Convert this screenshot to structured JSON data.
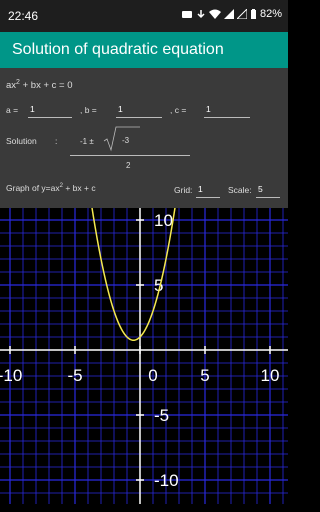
{
  "status": {
    "time": "22:46",
    "battery": "82%"
  },
  "app": {
    "title": "Solution of quadratic equation"
  },
  "equation": {
    "text_pre": "ax",
    "sup": "2",
    "text_post": " + bx + c = 0"
  },
  "inputs": {
    "a": {
      "label": "a =",
      "value": "1"
    },
    "b": {
      "label": ",  b =",
      "value": "1"
    },
    "c": {
      "label": ",  c =",
      "value": "1"
    }
  },
  "solution": {
    "label": "Solution",
    "colon": ":",
    "prefix": "-1 ±",
    "radicand": "-3",
    "denominator": "2"
  },
  "graph_label": {
    "pre": "Graph of y=ax",
    "sup": "2",
    "post": " + bx + c"
  },
  "grid": {
    "label": "Grid:",
    "value": "1"
  },
  "scale": {
    "label": "Scale:",
    "value": "5"
  },
  "colors": {
    "accent": "#009688",
    "curve": "#f5e94f",
    "grid": "#2a2ae0",
    "axis": "#ffffff"
  },
  "chart_data": {
    "type": "line",
    "series": [
      {
        "expression": "y = x^2 + x + 1"
      }
    ],
    "xlim": [
      -11.5,
      11.5
    ],
    "ylim": [
      -12.5,
      11.5
    ],
    "grid_step": 1,
    "label_step": 5,
    "x_tick_labels": [
      "-10",
      "-5",
      "0",
      "5",
      "10"
    ],
    "y_tick_labels": [
      "10",
      "5",
      "-5",
      "-10"
    ]
  }
}
